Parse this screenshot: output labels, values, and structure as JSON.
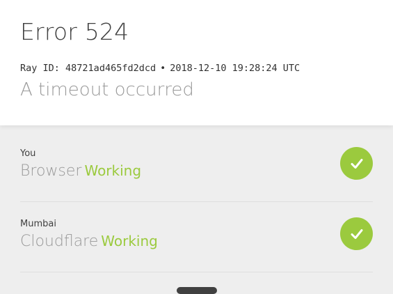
{
  "header": {
    "error_code": "Error 524",
    "ray_label": "Ray ID:",
    "ray_id": "48721ad465fd2dcd",
    "separator": "•",
    "timestamp": "2018-12-10 19:28:24 UTC",
    "subtitle": "A timeout occurred"
  },
  "status_items": [
    {
      "location": "You",
      "name": "Browser",
      "status": "Working",
      "icon": "check-icon"
    },
    {
      "location": "Mumbai",
      "name": "Cloudflare",
      "status": "Working",
      "icon": "check-icon"
    }
  ],
  "colors": {
    "working": "#9bca3e",
    "title": "#404040",
    "muted": "#999999",
    "background": "#eeeeee"
  }
}
